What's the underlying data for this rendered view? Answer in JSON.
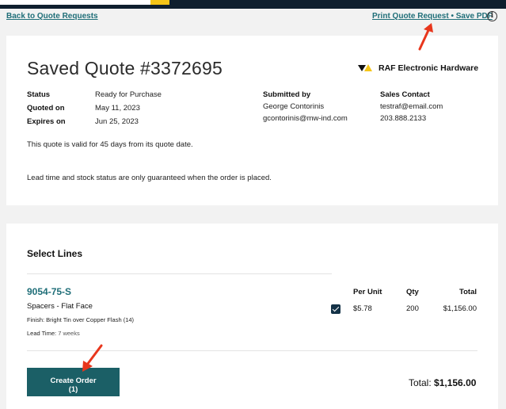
{
  "top_links": {
    "back": "Back to Quote Requests",
    "print_save": "Print Quote Request • Save PDF",
    "info_glyph": "i"
  },
  "quote": {
    "title": "Saved Quote #3372695",
    "brand": "RAF Electronic Hardware",
    "status_label": "Status",
    "status_value": "Ready for Purchase",
    "quoted_label": "Quoted on",
    "quoted_value": "May 11, 2023",
    "expires_label": "Expires on",
    "expires_value": "Jun 25, 2023",
    "submitted_label": "Submitted by",
    "submitted_name": "George Contorinis",
    "submitted_email": "gcontorinis@mw-ind.com",
    "contact_label": "Sales Contact",
    "contact_email": "testraf@email.com",
    "contact_phone": "203.888.2133",
    "validity_note": "This quote is valid for 45 days from its quote date.",
    "lead_note": "Lead time and stock status are only guaranteed when the order is placed."
  },
  "lines": {
    "title": "Select Lines",
    "headers": {
      "per_unit": "Per Unit",
      "qty": "Qty",
      "total": "Total"
    },
    "item": {
      "part_number": "9054-75-S",
      "description": "Spacers - Flat Face",
      "finish": "Finish: Bright Tin over Copper Flash (14)",
      "lead_label": "Lead Time:",
      "lead_value": "7 weeks",
      "per_unit": "$5.78",
      "qty": "200",
      "total": "$1,156.00",
      "checked": true
    },
    "create_button": "Create Order",
    "create_count": "(1)",
    "total_label": "Total:",
    "total_value": "$1,156.00"
  },
  "colors": {
    "accent": "#1f6e78",
    "button": "#1b5f66",
    "annotation_arrow": "#e8361c"
  }
}
